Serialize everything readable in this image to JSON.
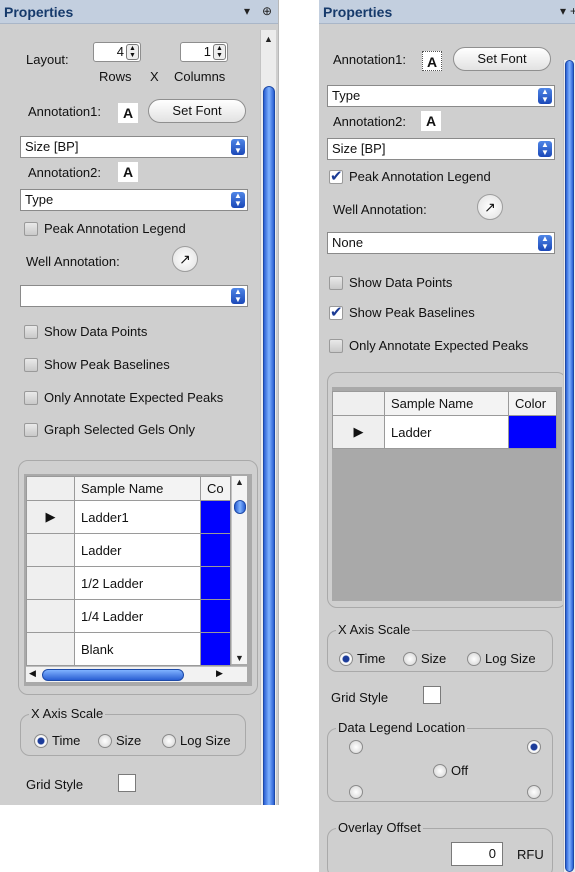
{
  "left_panel": {
    "title": "Properties",
    "pin_icons": [
      "▾",
      "⊕"
    ],
    "layout_label": "Layout:",
    "rows_value": "4",
    "columns_value": "1",
    "rows_label": "Rows",
    "x_label": "X",
    "columns_label": "Columns",
    "annotation1_label": "Annotation1:",
    "annotation_glyph": "A",
    "set_font_label": "Set Font",
    "annotation1_value": "Size [BP]",
    "annotation2_label": "Annotation2:",
    "annotation2_value": "Type",
    "peak_annotation_legend": {
      "label": "Peak Annotation Legend",
      "checked": false
    },
    "well_annotation_label": "Well Annotation:",
    "well_annotation_value": "",
    "show_data_points": {
      "label": "Show Data Points",
      "checked": false
    },
    "show_peak_baselines": {
      "label": "Show Peak Baselines",
      "checked": false
    },
    "only_annotate_expected": {
      "label": "Only Annotate Expected Peaks",
      "checked": false
    },
    "graph_selected_gels": {
      "label": "Graph Selected Gels Only",
      "checked": false
    },
    "table": {
      "columns": [
        "Sample Name",
        "Co"
      ],
      "rows": [
        {
          "name": "Ladder1",
          "color": "#0000ff",
          "current": true
        },
        {
          "name": "Ladder",
          "color": "#0000ff",
          "current": false
        },
        {
          "name": "1/2 Ladder",
          "color": "#0000ff",
          "current": false
        },
        {
          "name": "1/4 Ladder",
          "color": "#0000ff",
          "current": false
        },
        {
          "name": "Blank",
          "color": "#0000ff",
          "current": false
        }
      ]
    },
    "x_axis_scale": {
      "title": "X Axis Scale",
      "options": [
        "Time",
        "Size",
        "Log Size"
      ],
      "selected": "Time"
    },
    "grid_style_label": "Grid Style"
  },
  "right_panel": {
    "title": "Properties",
    "pin_icons": [
      "▾",
      "+"
    ],
    "annotation1_label": "Annotation1:",
    "annotation_glyph": "A",
    "set_font_label": "Set Font",
    "annotation1_value": "Type",
    "annotation2_label": "Annotation2:",
    "annotation2_value": "Size [BP]",
    "peak_annotation_legend": {
      "label": "Peak Annotation Legend",
      "checked": true
    },
    "well_annotation_label": "Well Annotation:",
    "well_annotation_value": "None",
    "show_data_points": {
      "label": "Show Data Points",
      "checked": false
    },
    "show_peak_baselines": {
      "label": "Show Peak Baselines",
      "checked": true
    },
    "only_annotate_expected": {
      "label": "Only Annotate Expected Peaks",
      "checked": false
    },
    "table": {
      "columns": [
        "Sample Name",
        "Color"
      ],
      "rows": [
        {
          "name": "Ladder",
          "color": "#0000ff",
          "current": true
        }
      ]
    },
    "x_axis_scale": {
      "title": "X Axis Scale",
      "options": [
        "Time",
        "Size",
        "Log Size"
      ],
      "selected": "Time"
    },
    "grid_style_label": "Grid Style",
    "data_legend_location": {
      "title": "Data Legend Location",
      "off_label": "Off",
      "selected": "top-right"
    },
    "overlay_offset": {
      "title": "Overlay Offset",
      "value": "0",
      "unit": "RFU"
    }
  },
  "colors": {
    "panel_bg": "#cfcfcf",
    "title_bg": "#c3cfdf",
    "title_text": "#163a6b",
    "accent_blue": "#2a5fd3",
    "sample_color": "#0000ff"
  }
}
